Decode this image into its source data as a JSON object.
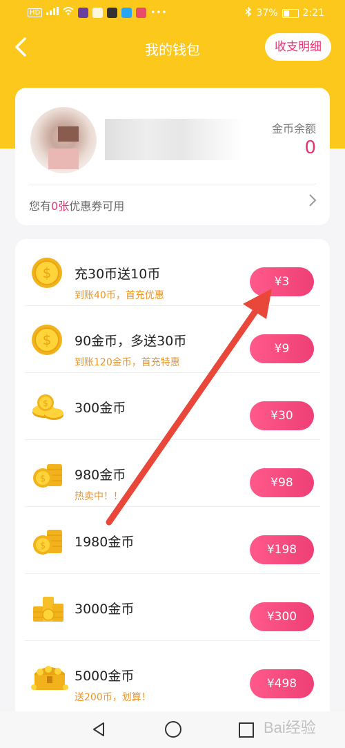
{
  "status_bar": {
    "left_label": "HD",
    "battery": "37%",
    "time": "2:21"
  },
  "nav": {
    "title": "我的钱包",
    "detail_button": "收支明细"
  },
  "wallet": {
    "balance_label": "金币余额",
    "balance_value": "0",
    "coupon_prefix": "您有",
    "coupon_count": "0张",
    "coupon_suffix": "优惠券可用"
  },
  "packages": [
    {
      "title": "充30币送10币",
      "subtitle": "到账40币，首充优惠",
      "price": "¥3",
      "icon": "coin-single-icon"
    },
    {
      "title": "90金币，多送30币",
      "subtitle": "到账120金币，首充特惠",
      "price": "¥9",
      "icon": "coin-single-icon"
    },
    {
      "title": "300金币",
      "subtitle": "",
      "price": "¥30",
      "icon": "coin-few-icon"
    },
    {
      "title": "980金币",
      "subtitle": "热卖中！！",
      "price": "¥98",
      "icon": "coin-stack-icon"
    },
    {
      "title": "1980金币",
      "subtitle": "",
      "price": "¥198",
      "icon": "coin-stack-icon"
    },
    {
      "title": "3000金币",
      "subtitle": "",
      "price": "¥300",
      "icon": "coin-pile-icon"
    },
    {
      "title": "5000金币",
      "subtitle": "送200币，划算！",
      "price": "¥498",
      "icon": "treasure-chest-icon"
    }
  ],
  "watermark": {
    "text": "Bai经验"
  },
  "colors": {
    "header": "#fcc81c",
    "accent": "#e8336e",
    "subtitle": "#e8952a",
    "annotation_arrow": "#e8473a"
  }
}
